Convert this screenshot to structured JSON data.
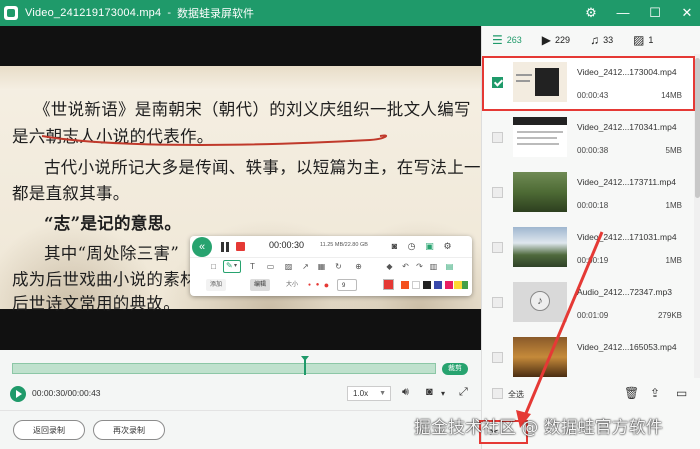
{
  "window": {
    "filename": "Video_241219173004.mp4",
    "separator": "-",
    "app_name": "数据蛙录屏软件",
    "controls": [
      "settings-icon",
      "minimize-icon",
      "maximize-icon",
      "close-icon"
    ]
  },
  "video_text": {
    "line1_a": "《世说新语》是南朝宋（朝代）的刘义庆组织一批文人编写",
    "line2": "是六朝志人小说的代表作。",
    "line3": "古代小说所记大多是传闻、轶事，以短篇为主，在写法上一",
    "line4": "都是直叙其事。",
    "line5_bold": "“志”是记的意思。",
    "line6": "其中“周处除三害”",
    "line7": "成为后世戏曲小说的素材",
    "line8": "后世诗文常用的典故。"
  },
  "float_toolbar": {
    "time": "00:00:30",
    "size": "11.25 MB/22.80 GB",
    "chip_a": "添加",
    "chip_b": "编辑",
    "size_label": "大小",
    "size_value": "9",
    "colors": [
      "#e53935",
      "#f4511e",
      "#ffffff",
      "#222222",
      "#3949ab",
      "#e91e63",
      "#fdd835",
      "#43a047"
    ]
  },
  "timeline": {
    "progress": 0.69,
    "clip_label": "裁剪"
  },
  "playback": {
    "time": "00:00:30/00:00:43",
    "speed": "1.0x"
  },
  "bottom_buttons": {
    "back": "返回录制",
    "again": "再次录制"
  },
  "tabs": [
    {
      "icon": "list-icon",
      "count": "263"
    },
    {
      "icon": "video-icon",
      "count": "229"
    },
    {
      "icon": "music-icon",
      "count": "33"
    },
    {
      "icon": "image-icon",
      "count": "1"
    }
  ],
  "files": [
    {
      "name": "Video_2412...173004.mp4",
      "duration": "00:00:43",
      "size": "14MB",
      "checked": true
    },
    {
      "name": "Video_2412...170341.mp4",
      "duration": "00:00:38",
      "size": "5MB",
      "checked": false
    },
    {
      "name": "Video_2412...173711.mp4",
      "duration": "00:00:18",
      "size": "1MB",
      "checked": false
    },
    {
      "name": "Video_2412...171031.mp4",
      "duration": "00:00:19",
      "size": "1MB",
      "checked": false
    },
    {
      "name": "Audio_2412...72347.mp3",
      "duration": "00:01:09",
      "size": "279KB",
      "checked": false
    },
    {
      "name": "Video_2412...165053.mp4",
      "duration": "",
      "size": "",
      "checked": false
    }
  ],
  "select_all": "全选",
  "watermark": "掘金技术社区 @ 数据蛙官方软件",
  "accent": "#1f9a6a",
  "highlight": "#e53935"
}
